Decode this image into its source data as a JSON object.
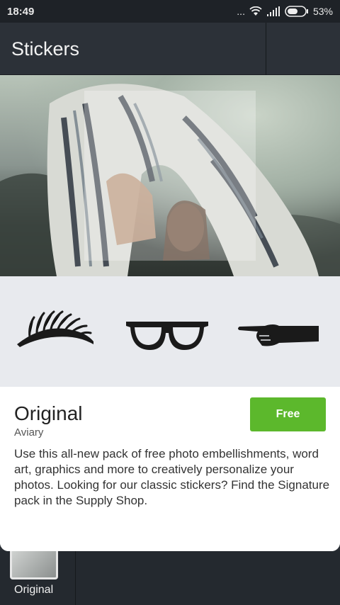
{
  "status_bar": {
    "time": "18:49",
    "dots": "...",
    "battery_percent": "53%"
  },
  "header": {
    "title": "Stickers"
  },
  "sticker_pack": {
    "name": "Original",
    "author": "Aviary",
    "button_label": "Free",
    "description": "Use this all-new pack of free photo embellishments, word art, graphics and more to creatively personalize your photos. Looking for our classic stickers? Find the Signature pack in the Supply Shop.",
    "preview_stickers": [
      "eyelash-icon",
      "glasses-icon",
      "pointing-hand-icon"
    ]
  },
  "tray": {
    "label": "Original"
  },
  "colors": {
    "accent_green": "#5cb82c",
    "header_bg": "#2c3138",
    "sticker_row_bg": "#e8eaee"
  }
}
